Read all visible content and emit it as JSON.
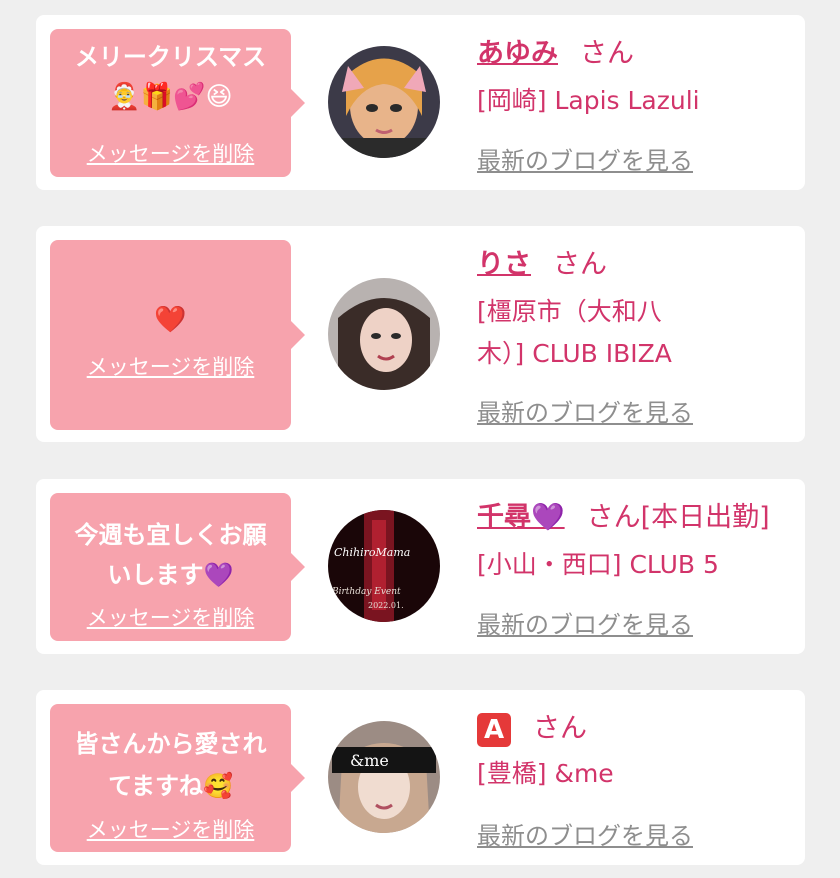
{
  "delete_label": "メッセージを削除",
  "san_label": "さん",
  "blog_label": "最新のブログを見る",
  "cards": [
    {
      "message_line1": "メリークリスマス",
      "message_line2": "🤶🎁💕😆",
      "name": "あゆみ",
      "status": "",
      "shop": "[岡崎] Lapis Lazuli",
      "avatar_icon": "avatar-photo"
    },
    {
      "message_line1": "❤️",
      "message_line2": "",
      "name": "りさ",
      "status": "",
      "shop_line1": "[橿原市（大和八",
      "shop_line2": "木）] CLUB IBIZA",
      "avatar_icon": "avatar-photo"
    },
    {
      "message_line1": "今週も宜しくお願",
      "message_line2": "いします💜",
      "name": "千尋💜",
      "status": "[本日出勤]",
      "shop": "[小山・西口] CLUB 5",
      "avatar_text": "ChihiroMama",
      "avatar_subtext": "Birthday Event",
      "avatar_date": "2022.01.",
      "avatar_icon": "avatar-photo"
    },
    {
      "message_line1": "皆さんから愛され",
      "message_line2": "てますね🥰",
      "name_badge": "A",
      "status": "",
      "shop": "[豊橋] &me",
      "avatar_text": "&me",
      "avatar_icon": "avatar-photo"
    }
  ],
  "colors": {
    "bubble": "#f7a3ad",
    "accent": "#d2346a",
    "link_gray": "#8e8e8e",
    "background": "#efefef"
  }
}
